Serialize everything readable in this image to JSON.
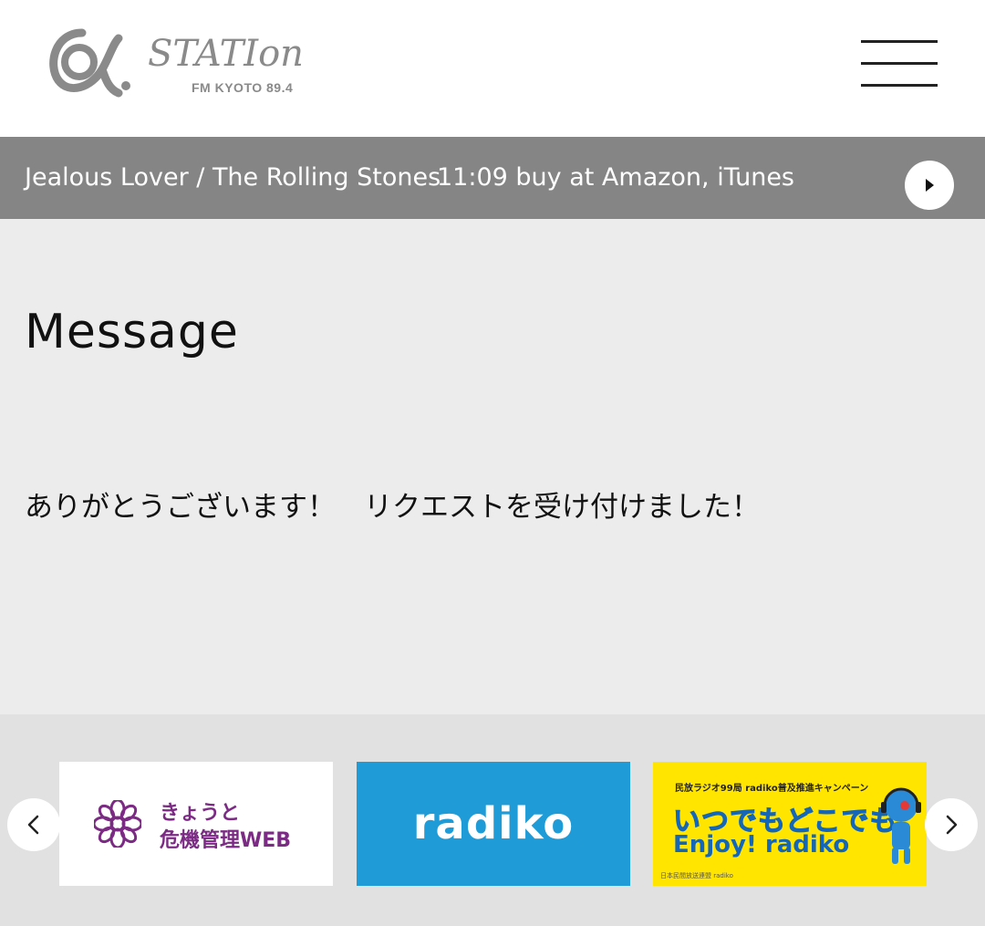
{
  "header": {
    "logo_alt": "α-STATION",
    "logo_sub": "FM KYOTO 89.4"
  },
  "now_playing": {
    "track": "Jealous Lover / The Rolling Stones",
    "time_and_links": "11:09 buy at Amazon, iTunes"
  },
  "message": {
    "title": "Message",
    "body": "ありがとうございます！　リクエストを受け付けました！"
  },
  "banners": {
    "kyoto": {
      "line1": "きょうと",
      "line2": "危機管理WEB"
    },
    "radiko": {
      "label": "radiko"
    },
    "campaign": {
      "top": "民放ラジオ99局 radiko普及推進キャンペーン",
      "main": "いつでもどこでも",
      "enjoy": "Enjoy! radiko",
      "foot": "日本民間放送連盟 radiko"
    }
  },
  "colors": {
    "now_playing_bg": "#858585",
    "content_bg": "#ececec",
    "radiko_blue": "#1f9cd7",
    "campaign_yellow": "#ffe500",
    "kyoto_purple": "#7b2b83"
  }
}
